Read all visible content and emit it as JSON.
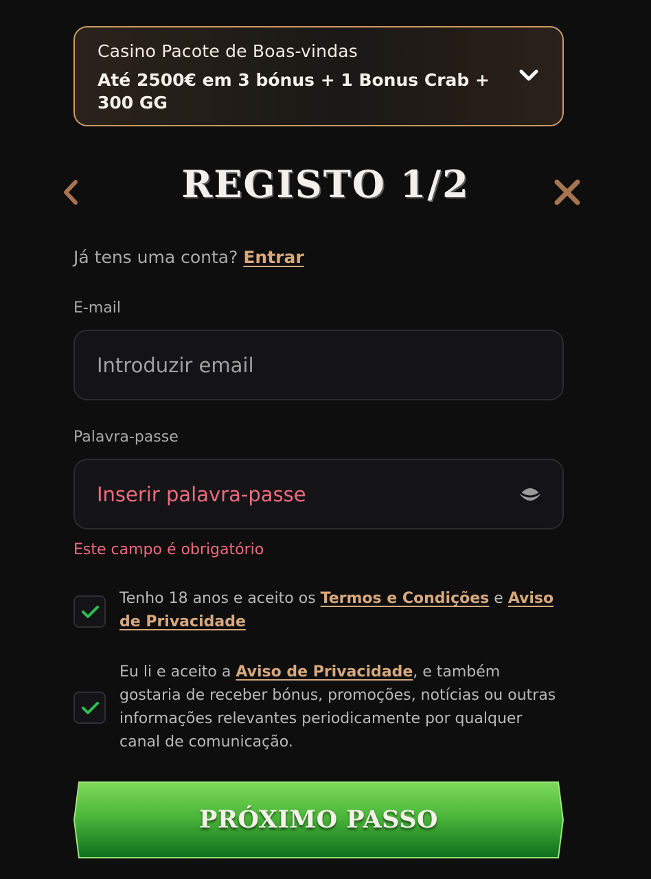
{
  "bonus": {
    "subtitle": "Casino Pacote de Boas-vindas",
    "title": "Até 2500€ em 3 bónus + 1 Bonus Crab + 300 GG"
  },
  "header": {
    "title": "REGISTO 1/2"
  },
  "login": {
    "prompt": "Já tens uma conta?",
    "link_label": "Entrar"
  },
  "email": {
    "label": "E-mail",
    "placeholder": "Introduzir email",
    "value": ""
  },
  "password": {
    "label": "Palavra-passe",
    "placeholder": "Inserir palavra-passe",
    "value": "",
    "error": "Este campo é obrigatório"
  },
  "consents": [
    {
      "checked": true,
      "text_before": "Tenho 18 anos e aceito os",
      "link1": "Termos e Condições",
      "text_middle": "e",
      "link2": "Aviso de Privacidade"
    },
    {
      "checked": true,
      "text_before": "Eu li e aceito a",
      "link1": "Aviso de Privacidade",
      "text_after": ", e também gostaria de receber bónus, promoções, notícias ou outras informações relevantes periodicamente por qualquer canal de comunicação."
    }
  ],
  "next_button": {
    "label": "PRÓXIMO PASSO"
  },
  "colors": {
    "accent_link": "#d7a87c",
    "banner_border": "#c99a63",
    "error": "#ee6a7e",
    "check": "#2fbe52",
    "button_green_top": "#7ed957",
    "button_green_bottom": "#0e6e1c",
    "icon_brown": "#a77452"
  },
  "icons": {
    "bonus_toggle": "chevron-down-icon",
    "back": "chevron-left-icon",
    "close": "close-icon",
    "password_visibility": "eye-icon",
    "checkbox": "check-icon"
  }
}
